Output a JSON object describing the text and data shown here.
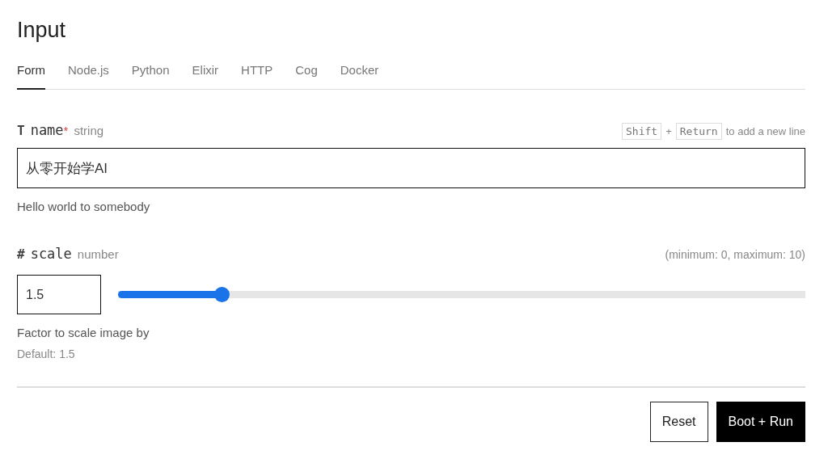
{
  "title": "Input",
  "tabs": [
    {
      "label": "Form",
      "selected": true
    },
    {
      "label": "Node.js",
      "selected": false
    },
    {
      "label": "Python",
      "selected": false
    },
    {
      "label": "Elixir",
      "selected": false
    },
    {
      "label": "HTTP",
      "selected": false
    },
    {
      "label": "Cog",
      "selected": false
    },
    {
      "label": "Docker",
      "selected": false
    }
  ],
  "fields": [
    {
      "kind": "text",
      "glyph": "T",
      "name": "name",
      "required_mark": "*",
      "type": "string",
      "hint_keys": [
        "Shift",
        "Return"
      ],
      "hint_plus": "+",
      "hint_text": "to add a new line",
      "value": "从零开始学AI",
      "description": "Hello world to somebody"
    },
    {
      "kind": "number",
      "glyph": "#",
      "name": "scale",
      "type": "number",
      "range": "(minimum: 0, maximum: 10)",
      "value": "1.5",
      "level": 0.15,
      "description": "Factor to scale image by",
      "default": "Default: 1.5"
    }
  ],
  "buttons": [
    {
      "label": "Reset",
      "kind": "secondary"
    },
    {
      "label": "Boot + Run",
      "kind": "primary"
    }
  ]
}
